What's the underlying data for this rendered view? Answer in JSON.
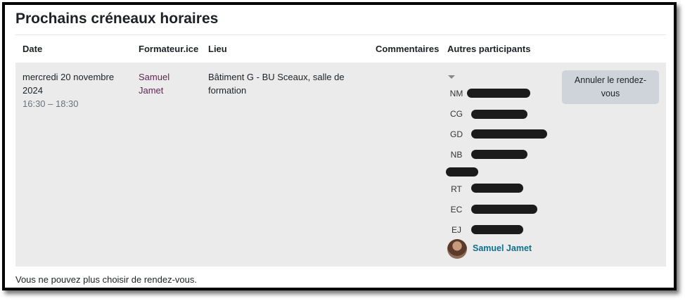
{
  "page": {
    "title": "Prochains créneaux horaires"
  },
  "table": {
    "headers": {
      "date": "Date",
      "trainer": "Formateur.ice",
      "place": "Lieu",
      "comments": "Commentaires",
      "participants": "Autres participants"
    },
    "row": {
      "date_line1": "mercredi 20 novembre",
      "date_line2": "2024",
      "time": "16:30 – 18:30",
      "trainer_first": "Samuel",
      "trainer_last": "Jamet",
      "place_line1": "Bâtiment G - BU Sceaux, salle de",
      "place_line2": "formation",
      "comments": "",
      "participants": [
        {
          "initials": "NM"
        },
        {
          "initials": "CG"
        },
        {
          "initials": "GD"
        },
        {
          "initials": "NB"
        },
        {
          "initials": ""
        },
        {
          "initials": "RT"
        },
        {
          "initials": "EC"
        },
        {
          "initials": "EJ"
        }
      ],
      "current_user": "Samuel Jamet",
      "cancel_label_line1": "Annuler le rendez-",
      "cancel_label_line2": "vous"
    }
  },
  "footer": {
    "message": "Vous ne pouvez plus choisir de rendez-vous."
  },
  "colors": {
    "link": "#5e2750",
    "user_link": "#0f6f8f",
    "row_bg": "#ebebeb",
    "button_bg": "#ced4da"
  }
}
